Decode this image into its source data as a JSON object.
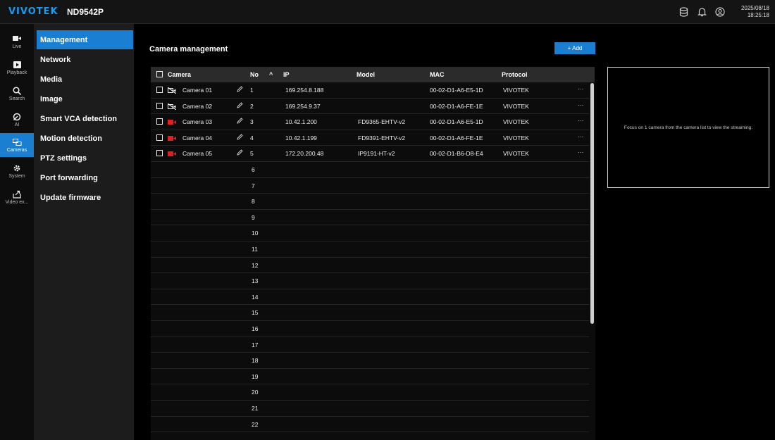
{
  "header": {
    "brand": "VIVOTEK",
    "model": "ND9542P",
    "date": "2025/08/18",
    "time": "18:25:18",
    "icons": [
      "database-icon",
      "bell-icon",
      "user-icon"
    ]
  },
  "rail": {
    "items": [
      {
        "label": "Live",
        "icon": "video-camera-icon"
      },
      {
        "label": "Playback",
        "icon": "playback-icon"
      },
      {
        "label": "Search",
        "icon": "search-icon"
      },
      {
        "label": "AI",
        "icon": "ai-icon"
      },
      {
        "label": "Cameras",
        "icon": "cameras-icon",
        "active": true
      },
      {
        "label": "System",
        "icon": "gear-icon"
      },
      {
        "label": "Video ex...",
        "icon": "export-icon"
      }
    ]
  },
  "menu": {
    "items": [
      {
        "label": "Management",
        "active": true
      },
      {
        "label": "Network"
      },
      {
        "label": "Media"
      },
      {
        "label": "Image"
      },
      {
        "label": "Smart VCA detection"
      },
      {
        "label": "Motion detection"
      },
      {
        "label": "PTZ settings"
      },
      {
        "label": "Port forwarding"
      },
      {
        "label": "Update firmware"
      }
    ]
  },
  "main": {
    "title": "Camera management",
    "add_label": "+ Add",
    "preview_text": "Focus on 1 camera from the camera list to view the streaming.",
    "columns": {
      "camera": "Camera",
      "no": "No",
      "sort_arrow": "^",
      "ip": "IP",
      "model": "Model",
      "mac": "MAC",
      "protocol": "Protocol"
    },
    "cameras": [
      {
        "name": "Camera 01",
        "no": "1",
        "ip": "169.254.8.188",
        "model": "",
        "mac": "00-02-D1-A6-E5-1D",
        "protocol": "VIVOTEK",
        "more": "···",
        "status": "disconnected"
      },
      {
        "name": "Camera 02",
        "no": "2",
        "ip": "169.254.9.37",
        "model": "",
        "mac": "00-02-D1-A6-FE-1E",
        "protocol": "VIVOTEK",
        "more": "···",
        "status": "disconnected"
      },
      {
        "name": "Camera 03",
        "no": "3",
        "ip": "10.42.1.200",
        "model": "FD9365-EHTV-v2",
        "mac": "00-02-D1-A6-E5-1D",
        "protocol": "VIVOTEK",
        "more": "···",
        "status": "recording"
      },
      {
        "name": "Camera 04",
        "no": "4",
        "ip": "10.42.1.199",
        "model": "FD9391-EHTV-v2",
        "mac": "00-02-D1-A6-FE-1E",
        "protocol": "VIVOTEK",
        "more": "···",
        "status": "recording"
      },
      {
        "name": "Camera 05",
        "no": "5",
        "ip": "172.20.200.48",
        "model": "IP9191-HT-v2",
        "mac": "00-02-D1-B6-D8-E4",
        "protocol": "VIVOTEK",
        "more": "···",
        "status": "recording"
      }
    ],
    "empty_rows": [
      "6",
      "7",
      "8",
      "9",
      "10",
      "11",
      "12",
      "13",
      "14",
      "15",
      "16",
      "17",
      "18",
      "19",
      "20",
      "21",
      "22"
    ]
  },
  "colors": {
    "accent": "#1a7fd0",
    "brand": "#1a9bf0",
    "recording": "#e02020"
  }
}
